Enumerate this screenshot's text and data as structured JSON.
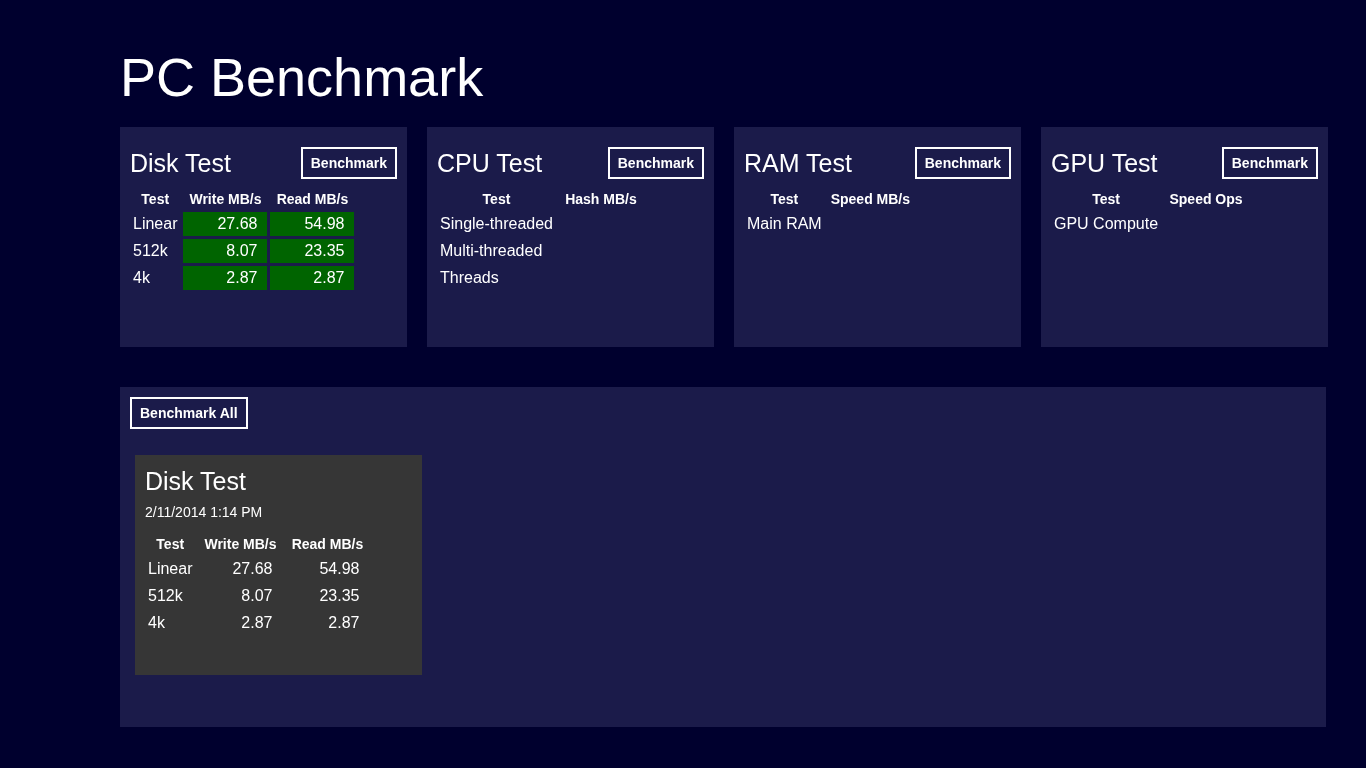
{
  "title": "PC Benchmark",
  "tests": [
    {
      "title": "Disk Test",
      "button": "Benchmark",
      "columns": [
        "Test",
        "Write MB/s",
        "Read MB/s"
      ],
      "rows": [
        {
          "label": "Linear",
          "values": [
            "27.68",
            "54.98"
          ],
          "highlighted": true
        },
        {
          "label": "512k",
          "values": [
            "8.07",
            "23.35"
          ],
          "highlighted": true
        },
        {
          "label": "4k",
          "values": [
            "2.87",
            "2.87"
          ],
          "highlighted": true
        }
      ]
    },
    {
      "title": "CPU Test",
      "button": "Benchmark",
      "columns": [
        "Test",
        "Hash MB/s"
      ],
      "rows": [
        {
          "label": "Single-threaded"
        },
        {
          "label": "Multi-threaded"
        },
        {
          "label": "Threads"
        }
      ]
    },
    {
      "title": "RAM Test",
      "button": "Benchmark",
      "columns": [
        "Test",
        "Speed MB/s"
      ],
      "rows": [
        {
          "label": "Main RAM"
        }
      ]
    },
    {
      "title": "GPU Test",
      "button": "Benchmark",
      "columns": [
        "Test",
        "Speed Ops"
      ],
      "rows": [
        {
          "label": "GPU Compute"
        }
      ]
    }
  ],
  "results": {
    "button": "Benchmark All",
    "cards": [
      {
        "title": "Disk Test",
        "date": "2/11/2014 1:14 PM",
        "columns": [
          "Test",
          "Write MB/s",
          "Read MB/s"
        ],
        "rows": [
          {
            "label": "Linear",
            "values": [
              "27.68",
              "54.98"
            ]
          },
          {
            "label": "512k",
            "values": [
              "8.07",
              "23.35"
            ]
          },
          {
            "label": "4k",
            "values": [
              "2.87",
              "2.87"
            ]
          }
        ]
      }
    ]
  }
}
